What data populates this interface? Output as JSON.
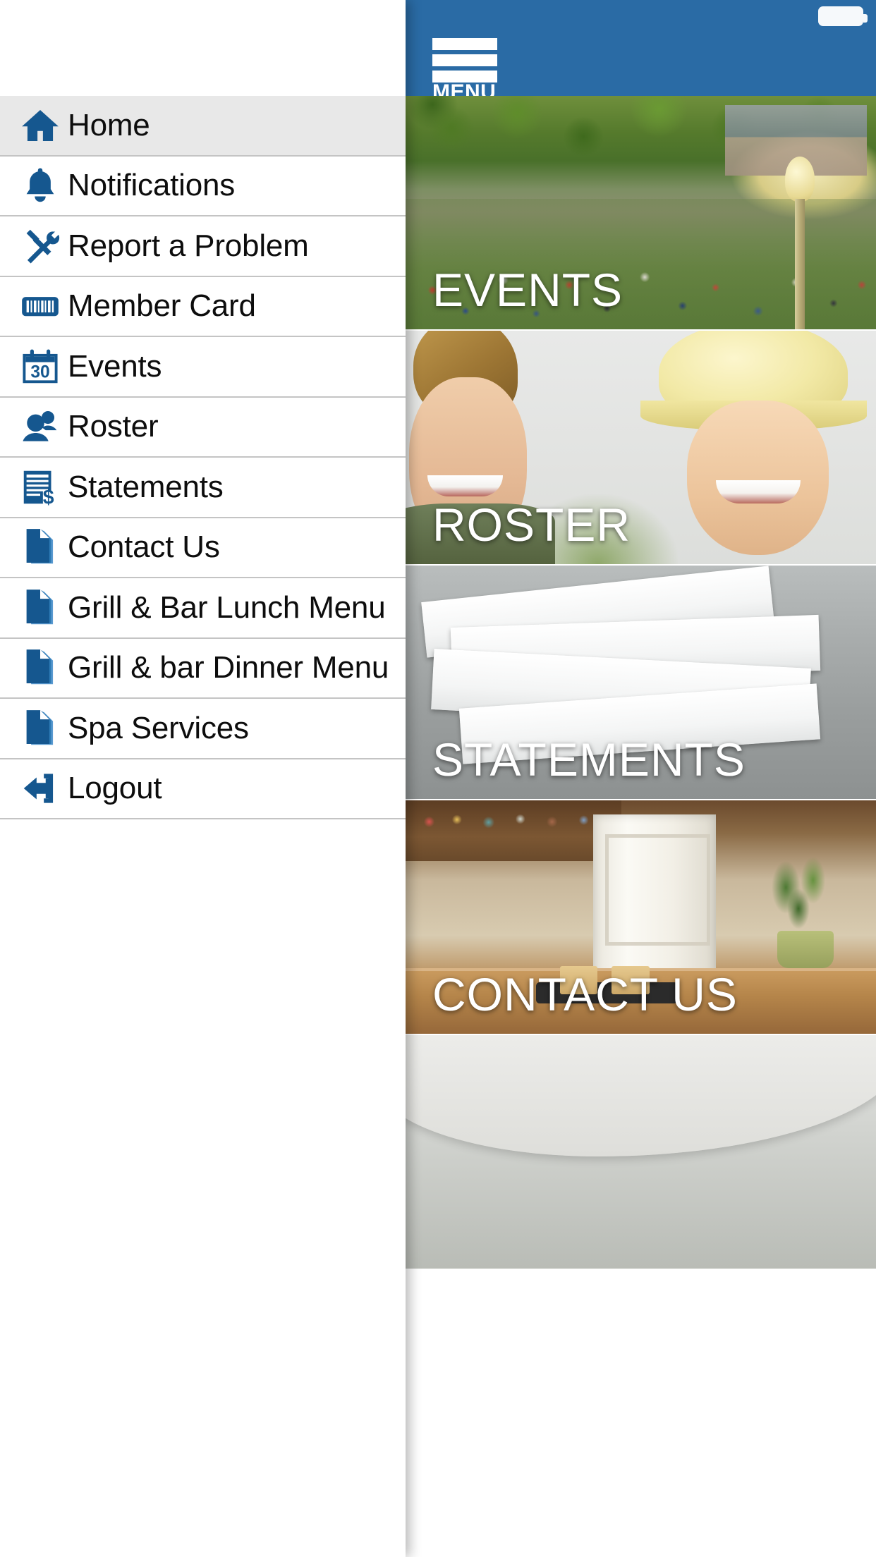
{
  "app": {
    "accent_color": "#2a6ba5",
    "drawer_active_color": "#e8e8e8",
    "icon_color": "#15578f",
    "tile_label_color": "#ffffff"
  },
  "status_bar": {
    "battery_icon": "battery-full-icon"
  },
  "app_bar": {
    "menu_label": "MENU",
    "menu_icon": "hamburger-menu-icon"
  },
  "drawer": {
    "items": [
      {
        "label": "Home",
        "icon": "home-icon",
        "active": true
      },
      {
        "label": "Notifications",
        "icon": "bell-icon",
        "active": false
      },
      {
        "label": "Report a Problem",
        "icon": "tools-icon",
        "active": false
      },
      {
        "label": "Member Card",
        "icon": "barcode-icon",
        "active": false
      },
      {
        "label": "Events",
        "icon": "calendar-30-icon",
        "active": false
      },
      {
        "label": "Roster",
        "icon": "people-icon",
        "active": false
      },
      {
        "label": "Statements",
        "icon": "invoice-icon",
        "active": false
      },
      {
        "label": "Contact Us",
        "icon": "document-icon",
        "active": false
      },
      {
        "label": "Grill & Bar Lunch Menu",
        "icon": "document-icon",
        "active": false
      },
      {
        "label": "Grill & bar Dinner Menu",
        "icon": "document-icon",
        "active": false
      },
      {
        "label": "Spa Services",
        "icon": "document-icon",
        "active": false
      },
      {
        "label": "Logout",
        "icon": "logout-icon",
        "active": false
      }
    ]
  },
  "home_tiles": [
    {
      "label": "EVENTS",
      "art": "events"
    },
    {
      "label": "ROSTER",
      "art": "roster"
    },
    {
      "label": "STATEMENTS",
      "art": "statements"
    },
    {
      "label": "CONTACT US",
      "art": "contact"
    },
    {
      "label": "",
      "art": "extra"
    }
  ]
}
